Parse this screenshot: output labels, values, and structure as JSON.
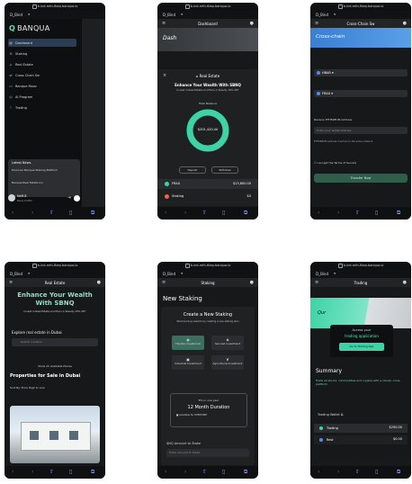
{
  "status_bar": {
    "url": "b-ind-mth-fbep.banqua.io"
  },
  "bind_label": "D_Bind",
  "screen1": {
    "logo": "BANQUA",
    "nav_items": [
      {
        "icon": "grid-icon",
        "glyph": "▦",
        "label": "Dashboard"
      },
      {
        "icon": "stack-icon",
        "glyph": "≋",
        "label": "Staking"
      },
      {
        "icon": "home-icon",
        "glyph": "⌂",
        "label": "Real Estate"
      },
      {
        "icon": "swap-icon",
        "glyph": "⇄",
        "label": "Cross Chain Sw"
      },
      {
        "icon": "card-icon",
        "glyph": "▭",
        "label": "Banque Moov"
      },
      {
        "icon": "robot-icon",
        "glyph": "◎",
        "label": "AI Program"
      },
      {
        "icon": "chart-icon",
        "glyph": "⌇",
        "label": "Trading"
      }
    ],
    "latest_news": {
      "title": "Latest News",
      "items": [
        "Discover Banqua Staking Platform",
        "Banqua Real Estate Inv"
      ]
    },
    "user": {
      "name": "NeR.8",
      "email": "Banq Profile"
    }
  },
  "screen2": {
    "title": "Dashboard",
    "banner": "Dash",
    "modal_title": "Real Estate",
    "headline": "Enhance Your Wealth With SBNQ",
    "subline": "Invest in Real Estate And Earn A Steady 10% APY",
    "total_balance_label": "Total Balance",
    "total_balance": "$201,420.40",
    "deposit": "Deposit",
    "withdraw": "Withdraw",
    "assets": [
      {
        "name": "FRAX",
        "value": "$13,800.00",
        "color": "#3ed3a6"
      },
      {
        "name": "Staking",
        "value": "$0",
        "color": "#e8674a"
      }
    ]
  },
  "screen3": {
    "title": "Cross-Chain Sw",
    "banner": "Cross-chain",
    "from": "HBAR",
    "to": "FRAX",
    "receive_label": "Receive ETHEREUM Address",
    "address_placeholder": "Enter your wallet address",
    "note": "ETHEREUM address must be on the same network",
    "terms": "I accept the Terms of Service",
    "submit": "Transfer Now"
  },
  "screen4": {
    "title": "Real Estate",
    "headline": "Enhance Your Wealth With SBNQ",
    "subline": "Invest in Real Estate And Earn A Steady 10% APY",
    "explore": "Explore real estate in Dubai",
    "search_placeholder": "Search Location",
    "show_all": "Show All Available Places",
    "props_prefix": "Properties for Sale in ",
    "props_city": "Dubai",
    "sort_by": "Sort By: Price High to Low"
  },
  "screen5": {
    "title": "Staking",
    "heading": "New Staking",
    "create_title": "Create a New Staking",
    "create_sub": "Start earning rewards by creating a new staking plan",
    "options": [
      "Flexible Investment",
      "Secured Investment",
      "Industrial Investment",
      "Agricultural Investment"
    ],
    "apy": "8% in one year",
    "duration": "12 Month Duration",
    "avail": "Available for EVERYONE",
    "amount_label": "$NQ Amount to Stake",
    "amount_placeholder": "Enter Amount to Stake"
  },
  "screen6": {
    "title": "Trading",
    "banner": "Qur",
    "card_line1": "Access your",
    "card_line2": "trading application",
    "card_btn": "Go to Trading App",
    "summary": "Summary",
    "summary_text": "Trade all stocks, commodities and cryptos with a robust, cross-platform",
    "wallet_label": "Trading Wallet",
    "rows": [
      {
        "name": "Trading",
        "value": "$250.00",
        "color": "#3ed3a6"
      },
      {
        "name": "Rest",
        "value": "$0.00",
        "color": "#4c8bf5"
      }
    ]
  }
}
